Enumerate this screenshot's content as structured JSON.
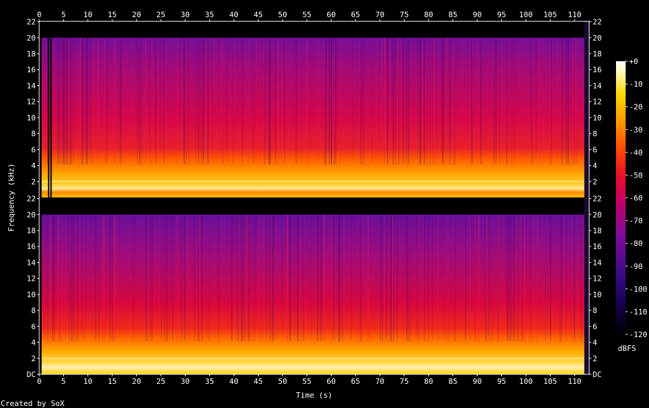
{
  "chart_data": {
    "type": "heatmap",
    "title": "",
    "xlabel": "Time (s)",
    "ylabel": "Frequency (kHz)",
    "colorbar_label": "dBFS",
    "credit": "Created by SoX",
    "xlim": [
      0,
      113
    ],
    "ylim_khz": [
      0,
      22.05
    ],
    "x_ticks": [
      "0",
      "5",
      "10",
      "15",
      "20",
      "25",
      "30",
      "35",
      "40",
      "45",
      "50",
      "55",
      "60",
      "65",
      "70",
      "75",
      "80",
      "85",
      "90",
      "95",
      "100",
      "105",
      "110"
    ],
    "y_ticks_top": [
      "22",
      "20",
      "18",
      "16",
      "14",
      "12",
      "10",
      "8",
      "6",
      "4",
      "2"
    ],
    "y_ticks_bottom": [
      "22",
      "20",
      "18",
      "16",
      "14",
      "12",
      "10",
      "8",
      "6",
      "4",
      "2",
      "DC"
    ],
    "colorbar_ticks": [
      "+0",
      "-10",
      "-20",
      "-30",
      "-40",
      "-50",
      "-60",
      "-70",
      "-80",
      "-90",
      "-100",
      "-110",
      "-120"
    ],
    "colorbar_range_db": [
      -120,
      0
    ],
    "channels": [
      {
        "name": "",
        "cutoff_khz": 20,
        "body_db": -62,
        "low_band_khz": 4,
        "low_band_db": -38
      },
      {
        "name": "",
        "cutoff_khz": 20,
        "body_db": -64,
        "low_band_khz": 4.5,
        "low_band_db": -36
      }
    ],
    "audio_start_s": 0.5,
    "audio_end_s": 112
  }
}
